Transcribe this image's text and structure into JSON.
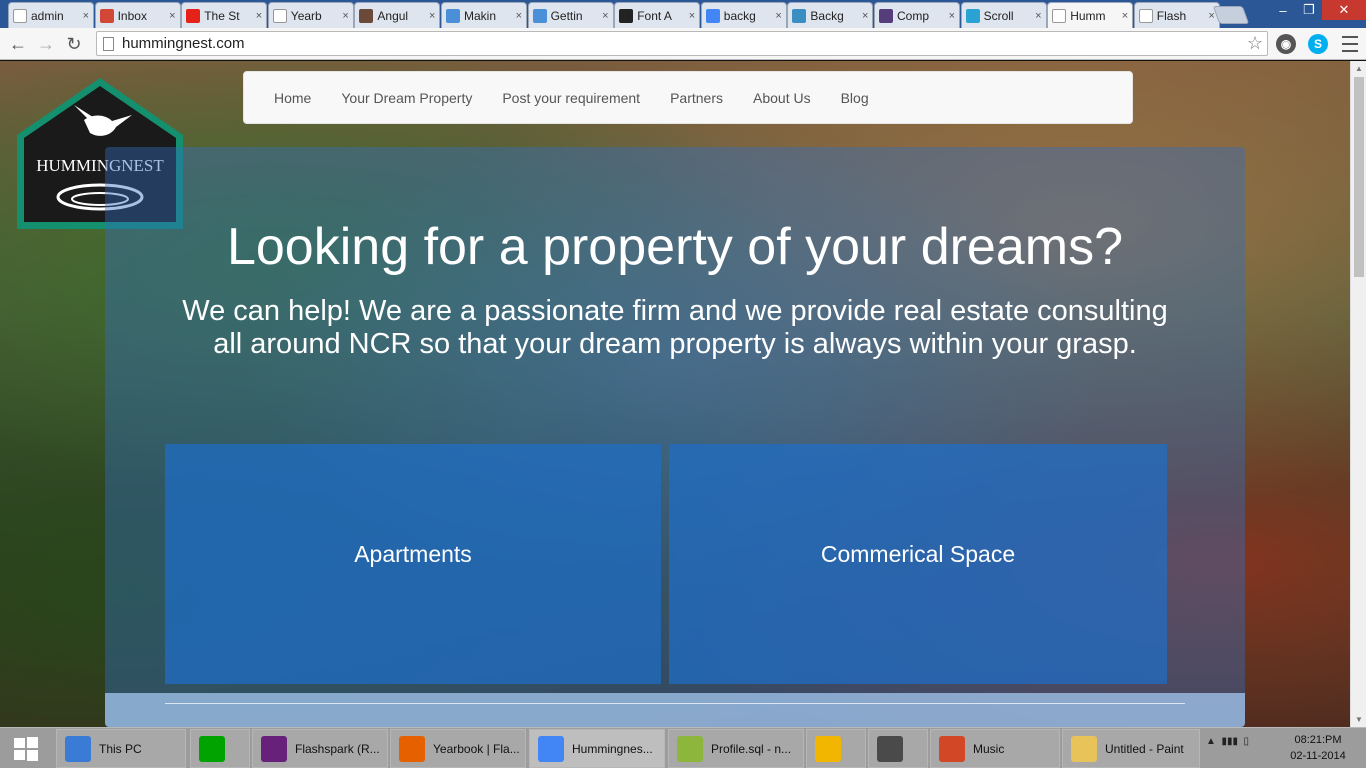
{
  "browser": {
    "tabs": [
      {
        "title": "admin",
        "icon": "doc-icon",
        "color": "#ffffff"
      },
      {
        "title": "Inbox",
        "icon": "gmail-icon",
        "color": "#d14836"
      },
      {
        "title": "The St",
        "icon": "youtube-icon",
        "color": "#e62117"
      },
      {
        "title": "Yearb",
        "icon": "doc-icon",
        "color": "#ffffff"
      },
      {
        "title": "Angul",
        "icon": "angular-icon",
        "color": "#6b4a3a"
      },
      {
        "title": "Makin",
        "icon": "kinvey-icon",
        "color": "#4a90d9"
      },
      {
        "title": "Gettin",
        "icon": "kinvey-icon",
        "color": "#4a90d9"
      },
      {
        "title": "Font A",
        "icon": "flag-icon",
        "color": "#222222"
      },
      {
        "title": "backg",
        "icon": "google-icon",
        "color": "#4285f4"
      },
      {
        "title": "Backg",
        "icon": "bootstrap3-icon",
        "color": "#3b8ec2"
      },
      {
        "title": "Comp",
        "icon": "bootstrap-icon",
        "color": "#563d7c"
      },
      {
        "title": "Scroll",
        "icon": "scroll-icon",
        "color": "#2aa3d4"
      },
      {
        "title": "Humm",
        "icon": "doc-icon",
        "color": "#ffffff"
      },
      {
        "title": "Flash",
        "icon": "doc-icon",
        "color": "#ffffff"
      }
    ],
    "close_glyph": "×",
    "url": "hummingnest.com"
  },
  "page": {
    "nav": [
      "Home",
      "Your Dream Property",
      "Post your requirement",
      "Partners",
      "About Us",
      "Blog"
    ],
    "logo_text": "HUMMINGNEST",
    "hero_title": "Looking for a property of your dreams?",
    "hero_text": "We can help! We are a passionate firm and we provide real estate consulting all around NCR so that your dream property is always within your grasp.",
    "cards": [
      "Apartments",
      "Commerical Space"
    ]
  },
  "taskbar": {
    "items": [
      {
        "label": "This PC",
        "icon": "computer-icon",
        "color": "#3a7bd5"
      },
      {
        "label": "",
        "icon": "store-icon",
        "color": "#00a300"
      },
      {
        "label": "Flashspark (R...",
        "icon": "visual-studio-icon",
        "color": "#68217a"
      },
      {
        "label": "Yearbook | Fla...",
        "icon": "firefox-icon",
        "color": "#e66000"
      },
      {
        "label": "Hummingnes...",
        "icon": "chrome-icon",
        "color": "#4285f4"
      },
      {
        "label": "Profile.sql - n...",
        "icon": "notepadpp-icon",
        "color": "#8db63c"
      },
      {
        "label": "",
        "icon": "chrome-canary-icon",
        "color": "#f2b600"
      },
      {
        "label": "",
        "icon": "sublime-icon",
        "color": "#4a4a4a"
      },
      {
        "label": "Music",
        "icon": "music-icon",
        "color": "#d24726"
      },
      {
        "label": "Untitled - Paint",
        "icon": "paint-icon",
        "color": "#e8c35a"
      }
    ],
    "time": "08:21:PM",
    "date": "02-11-2014"
  }
}
